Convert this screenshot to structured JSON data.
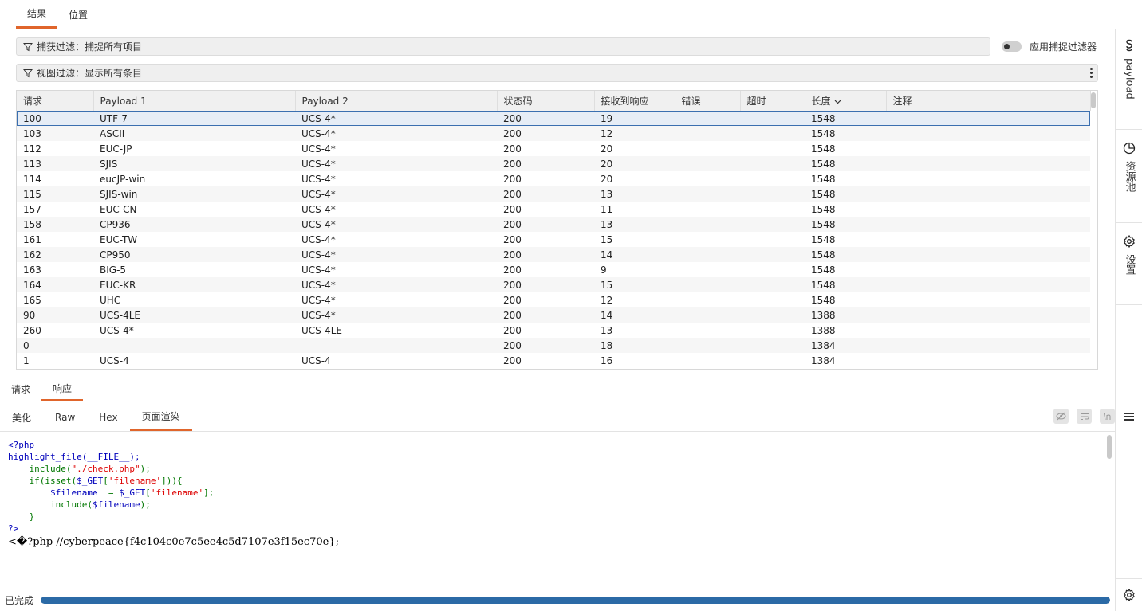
{
  "top_tabs": [
    {
      "label": "结果"
    },
    {
      "label": "位置"
    }
  ],
  "capture_filter": {
    "label": "捕获过滤：捕捉所有项目"
  },
  "apply_filter": {
    "label": "应用捕捉过滤器"
  },
  "view_filter": {
    "label": "视图过滤：显示所有条目"
  },
  "table": {
    "columns": [
      "请求",
      "Payload 1",
      "Payload 2",
      "状态码",
      "接收到响应",
      "错误",
      "超时",
      "长度",
      "注释"
    ],
    "rows": [
      {
        "req": "100",
        "p1": "UTF-7",
        "p2": "UCS-4*",
        "status": "200",
        "resp": "19",
        "len": "1548"
      },
      {
        "req": "103",
        "p1": "ASCII",
        "p2": "UCS-4*",
        "status": "200",
        "resp": "12",
        "len": "1548"
      },
      {
        "req": "112",
        "p1": "EUC-JP",
        "p2": "UCS-4*",
        "status": "200",
        "resp": "20",
        "len": "1548"
      },
      {
        "req": "113",
        "p1": "SJIS",
        "p2": "UCS-4*",
        "status": "200",
        "resp": "20",
        "len": "1548"
      },
      {
        "req": "114",
        "p1": "eucJP-win",
        "p2": "UCS-4*",
        "status": "200",
        "resp": "20",
        "len": "1548"
      },
      {
        "req": "115",
        "p1": "SJIS-win",
        "p2": "UCS-4*",
        "status": "200",
        "resp": "13",
        "len": "1548"
      },
      {
        "req": "157",
        "p1": "EUC-CN",
        "p2": "UCS-4*",
        "status": "200",
        "resp": "11",
        "len": "1548"
      },
      {
        "req": "158",
        "p1": "CP936",
        "p2": "UCS-4*",
        "status": "200",
        "resp": "13",
        "len": "1548"
      },
      {
        "req": "161",
        "p1": "EUC-TW",
        "p2": "UCS-4*",
        "status": "200",
        "resp": "15",
        "len": "1548"
      },
      {
        "req": "162",
        "p1": "CP950",
        "p2": "UCS-4*",
        "status": "200",
        "resp": "14",
        "len": "1548"
      },
      {
        "req": "163",
        "p1": "BIG-5",
        "p2": "UCS-4*",
        "status": "200",
        "resp": "9",
        "len": "1548"
      },
      {
        "req": "164",
        "p1": "EUC-KR",
        "p2": "UCS-4*",
        "status": "200",
        "resp": "15",
        "len": "1548"
      },
      {
        "req": "165",
        "p1": "UHC",
        "p2": "UCS-4*",
        "status": "200",
        "resp": "12",
        "len": "1548"
      },
      {
        "req": "90",
        "p1": "UCS-4LE",
        "p2": "UCS-4*",
        "status": "200",
        "resp": "14",
        "len": "1388"
      },
      {
        "req": "260",
        "p1": "UCS-4*",
        "p2": "UCS-4LE",
        "status": "200",
        "resp": "13",
        "len": "1388"
      },
      {
        "req": "0",
        "p1": "",
        "p2": "",
        "status": "200",
        "resp": "18",
        "len": "1384"
      },
      {
        "req": "1",
        "p1": "UCS-4",
        "p2": "UCS-4",
        "status": "200",
        "resp": "16",
        "len": "1384"
      }
    ]
  },
  "lower_tabs": [
    {
      "label": "请求"
    },
    {
      "label": "响应"
    }
  ],
  "sub_tabs": [
    {
      "label": "美化"
    },
    {
      "label": "Raw"
    },
    {
      "label": "Hex"
    },
    {
      "label": "页面渲染"
    }
  ],
  "code": {
    "line1": "<?php",
    "line2": "highlight_file(__FILE__);",
    "line3a": "    include(",
    "line3b": "\"./check.php\"",
    "line3c": ");",
    "line4a": "    if(isset(",
    "line4b": "$_GET",
    "line4c": "[",
    "line4d": "'filename'",
    "line4e": "])){",
    "line5a": "        $filename  ",
    "line5b": "= ",
    "line5c": "$_GET",
    "line5d": "[",
    "line5e": "'filename'",
    "line5f": "];",
    "line6a": "        include(",
    "line6b": "$filename",
    "line6c": ");",
    "line7": "    }",
    "line8": "?>",
    "rendered": "<�?php //cyberpeace{f4c104c0e7c5ee4c5d7107e3f15ec70e};"
  },
  "status": {
    "text": "已完成",
    "progress": 1.0
  },
  "sidebar": {
    "payload_label": "payload",
    "resource_label": "资源池",
    "settings_label": "设置"
  },
  "colors": {
    "accent": "#e0652b",
    "progress": "#2b6aa6",
    "php_default": "#0000bb",
    "php_keyword": "#007700",
    "php_string": "#dd0000"
  }
}
